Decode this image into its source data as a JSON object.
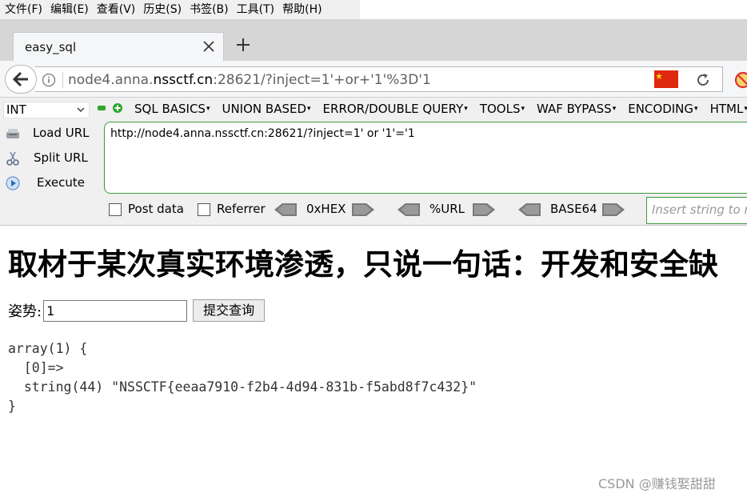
{
  "menubar": {
    "items": [
      "文件(F)",
      "编辑(E)",
      "查看(V)",
      "历史(S)",
      "书签(B)",
      "工具(T)",
      "帮助(H)"
    ]
  },
  "tab": {
    "title": "easy_sql"
  },
  "urlbar": {
    "url_host_pre": "node4.anna.",
    "url_domain": "nssctf.cn",
    "url_rest": ":28621/?inject=1'+or+'1'%3D'1"
  },
  "hackbar": {
    "type_select": "INT",
    "menus": [
      "SQL BASICS",
      "UNION BASED",
      "ERROR/DOUBLE QUERY",
      "TOOLS",
      "WAF BYPASS",
      "ENCODING",
      "HTML"
    ],
    "actions": [
      "Load URL",
      "Split URL",
      "Execute"
    ],
    "url_value": "http://node4.anna.nssctf.cn:28621/?inject=1' or '1'='1",
    "post_data_label": "Post data",
    "referrer_label": "Referrer",
    "hex_label": "0xHEX",
    "url_label": "%URL",
    "base64_label": "BASE64",
    "insert_placeholder": "Insert string to re"
  },
  "page": {
    "heading": "取材于某次真实环境渗透，只说一句话：开发和安全缺",
    "form_label": "姿势:",
    "input_value": "1",
    "submit_label": "提交查询",
    "dump_line1": "array(1) {",
    "dump_line2": "  [0]=>",
    "dump_line3": "  string(44) \"NSSCTF{eeaa7910-f2b4-4d94-831b-f5abd8f7c432}\"",
    "dump_line4": "}"
  },
  "watermark": "CSDN @赚钱娶甜甜",
  "colors": {
    "hackbar_green": "#3c9a3c",
    "flag_red": "#de2910"
  }
}
